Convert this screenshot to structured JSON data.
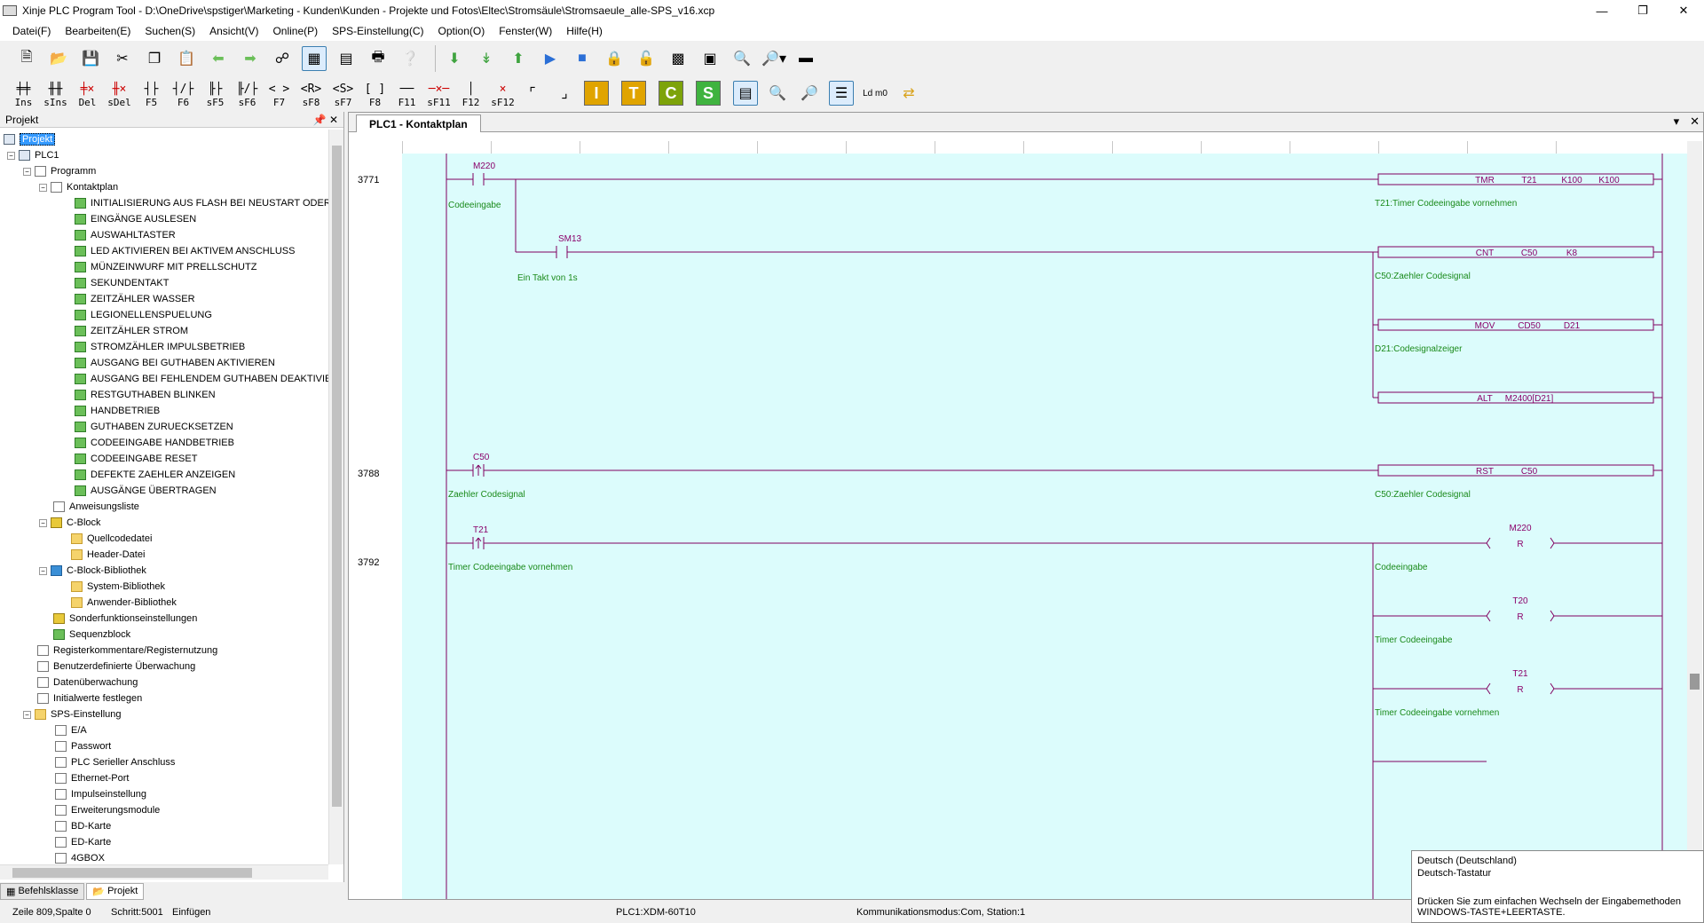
{
  "window": {
    "title": "Xinje PLC Program Tool - D:\\OneDrive\\spstiger\\Marketing - Kunden\\Kunden - Projekte und Fotos\\Eltec\\Stromsäule\\Stromsaeule_alle-SPS_v16.xcp"
  },
  "menu": [
    "Datei(F)",
    "Bearbeiten(E)",
    "Suchen(S)",
    "Ansicht(V)",
    "Online(P)",
    "SPS-Einstellung(C)",
    "Option(O)",
    "Fenster(W)",
    "Hilfe(H)"
  ],
  "toolbar2": {
    "keys": [
      "Ins",
      "sIns",
      "Del",
      "sDel",
      "F5",
      "F6",
      "sF5",
      "sF6",
      "F7",
      "sF8",
      "sF7",
      "F8",
      "F11",
      "sF11",
      "F12",
      "sF12"
    ],
    "big_letters": [
      "I",
      "T",
      "C",
      "S"
    ],
    "ldm_label": "Ld m0"
  },
  "project": {
    "panel_title": "Projekt",
    "root": "Projekt",
    "plc": "PLC1",
    "programm": "Programm",
    "kontaktplan": "Kontaktplan",
    "rungs": [
      "INITIALISIERUNG AUS FLASH BEI NEUSTART ODER MA",
      "EINGÄNGE AUSLESEN",
      "AUSWAHLTASTER",
      "LED AKTIVIEREN BEI AKTIVEM ANSCHLUSS",
      "MÜNZEINWURF MIT PRELLSCHUTZ",
      "SEKUNDENTAKT",
      "ZEITZÄHLER WASSER",
      "LEGIONELLENSPUELUNG",
      "ZEITZÄHLER STROM",
      "STROMZÄHLER IMPULSBETRIEB",
      "AUSGANG BEI GUTHABEN AKTIVIEREN",
      "AUSGANG BEI FEHLENDEM GUTHABEN DEAKTIVIEREN",
      "RESTGUTHABEN BLINKEN",
      "HANDBETRIEB",
      "GUTHABEN ZURUECKSETZEN",
      "CODEEINGABE HANDBETRIEB",
      "CODEEINGABE RESET",
      "DEFEKTE ZAEHLER ANZEIGEN",
      "AUSGÄNGE ÜBERTRAGEN"
    ],
    "anweisungsliste": "Anweisungsliste",
    "cblock": "C-Block",
    "quellcode": "Quellcodedatei",
    "header": "Header-Datei",
    "cbib": "C-Block-Bibliothek",
    "sysbib": "System-Bibliothek",
    "anwbib": "Anwender-Bibliothek",
    "sonder": "Sonderfunktionseinstellungen",
    "sequenz": "Sequenzblock",
    "register": "Registerkommentare/Registernutzung",
    "benutzer": "Benutzerdefinierte Überwachung",
    "daten": "Datenüberwachung",
    "initial": "Initialwerte festlegen",
    "sps": "SPS-Einstellung",
    "sps_items": [
      "E/A",
      "Passwort",
      "PLC Serieller Anschluss",
      "Ethernet-Port",
      "Impulseinstellung",
      "Erweiterungsmodule",
      "BD-Karte",
      "ED-Karte",
      "4GBOX"
    ]
  },
  "left_tabs": [
    "Befehlsklasse",
    "Projekt"
  ],
  "editor": {
    "tab": "PLC1 - Kontaktplan",
    "rung_numbers": [
      "3771",
      "3788",
      "3792"
    ],
    "contacts": [
      {
        "addr": "M220",
        "comment": "Codeeingabe"
      },
      {
        "addr": "SM13",
        "comment": "Ein Takt von 1s"
      },
      {
        "addr": "C50",
        "comment": "Zaehler Codesignal"
      },
      {
        "addr": "T21",
        "comment": "Timer Codeeingabe vornehmen"
      }
    ],
    "instructions": [
      {
        "op": "TMR",
        "a": "T21",
        "b": "K100",
        "c": "K100",
        "comment": "T21:Timer Codeeingabe vornehmen"
      },
      {
        "op": "CNT",
        "a": "C50",
        "b": "K8",
        "c": "",
        "comment": "C50:Zaehler Codesignal"
      },
      {
        "op": "MOV",
        "a": "CD50",
        "b": "D21",
        "c": "",
        "comment": "D21:Codesignalzeiger"
      },
      {
        "op": "ALT",
        "a": "M2400[D21]",
        "b": "",
        "c": "",
        "comment": ""
      },
      {
        "op": "RST",
        "a": "C50",
        "b": "",
        "c": "",
        "comment": "C50:Zaehler Codesignal"
      }
    ],
    "coils": [
      {
        "addr": "M220",
        "type": "R",
        "comment": "Codeeingabe"
      },
      {
        "addr": "T20",
        "type": "R",
        "comment": "Timer Codeeingabe"
      },
      {
        "addr": "T21",
        "type": "R",
        "comment": "Timer Codeeingabe vornehmen"
      }
    ]
  },
  "status": {
    "pos": "Zeile 809,Spalte 0",
    "step": "Schritt:5001",
    "mode": "Einfügen",
    "plc": "PLC1:XDM-60T10",
    "comm": "Kommunikationsmodus:Com, Station:1"
  },
  "ime": {
    "lang": "Deutsch (Deutschland)",
    "kb": "Deutsch-Tastatur",
    "hint1": "Drücken Sie zum einfachen Wechseln der Eingabemethoden",
    "hint2": "WINDOWS-TASTE+LEERTASTE."
  },
  "colors": {
    "ladder_bg": "#dcfcfc",
    "ladder_line": "#800060",
    "ladder_text": "#8a006a",
    "comment_green": "#1a8a1a"
  }
}
